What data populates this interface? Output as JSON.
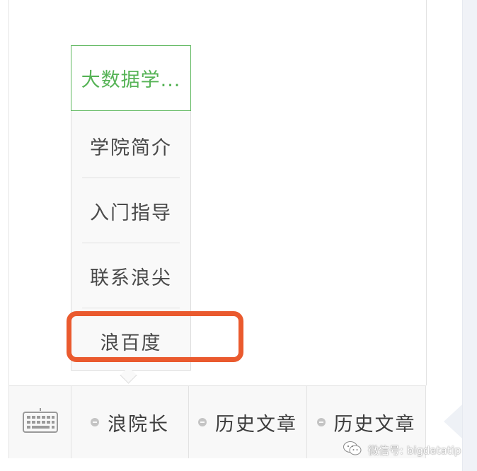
{
  "popup_menu": {
    "title": "大数据学...",
    "items": [
      {
        "label": "学院简介"
      },
      {
        "label": "入门指导"
      },
      {
        "label": "联系浪尖"
      },
      {
        "label": "浪百度"
      }
    ]
  },
  "bottom_menu": {
    "keyboard_icon": "keyboard-icon",
    "items": [
      {
        "label": "浪院长"
      },
      {
        "label": "历史文章"
      },
      {
        "label": "历史文章"
      }
    ]
  },
  "watermark": {
    "text": "微信号: bigdatatip",
    "icon": "wechat-icon"
  },
  "colors": {
    "accent_green": "#56b356",
    "highlight_orange": "#ea5a2e"
  }
}
